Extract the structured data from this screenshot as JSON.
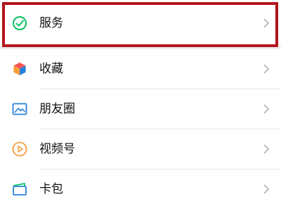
{
  "menu": {
    "items": [
      {
        "label": "服务",
        "icon": "service-check-icon",
        "color": "#07c160"
      },
      {
        "label": "收藏",
        "icon": "favorites-cube-icon",
        "color": "#fa9d3b"
      },
      {
        "label": "朋友圈",
        "icon": "moments-photo-icon",
        "color": "#2782d7"
      },
      {
        "label": "视频号",
        "icon": "channels-play-icon",
        "color": "#fa9d3b"
      },
      {
        "label": "卡包",
        "icon": "card-wallet-icon",
        "color": "#2782d7"
      }
    ]
  },
  "highlight_color": "#b4141e"
}
